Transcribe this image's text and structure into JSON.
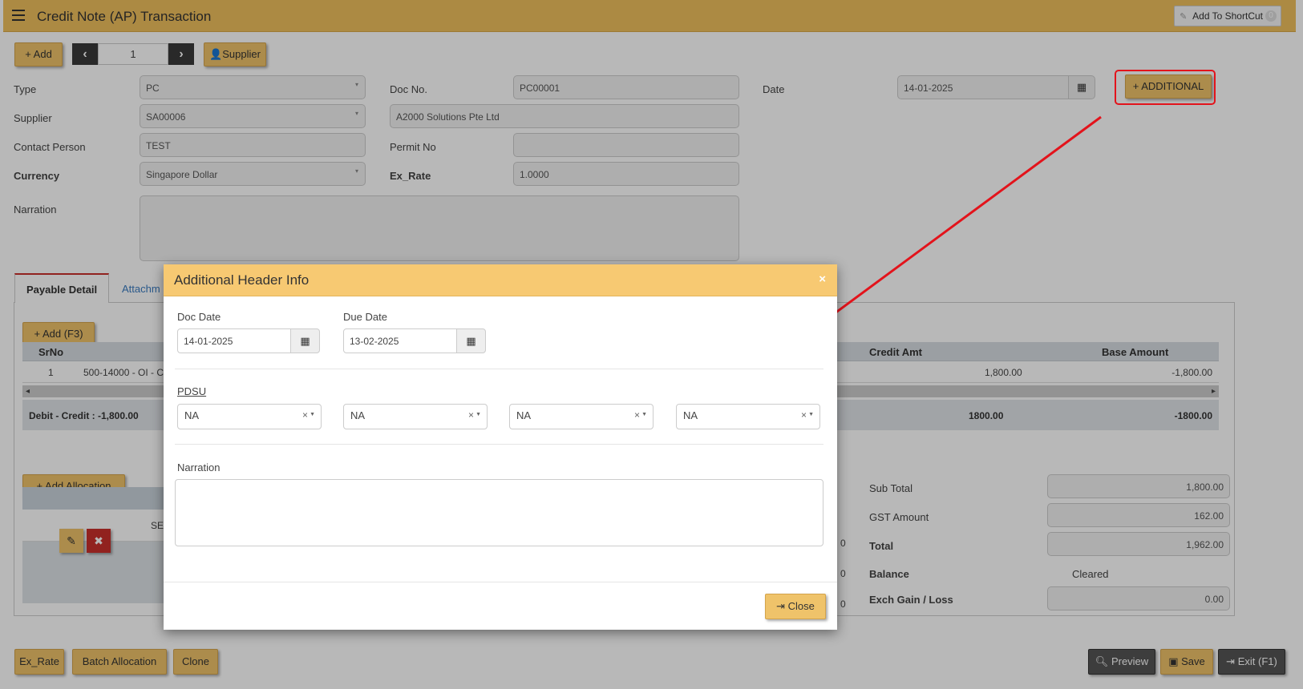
{
  "window": {
    "title": "Credit Note (AP) Transaction",
    "shortcut_label": "Add To ShortCut",
    "shortcut_count": "0"
  },
  "toolbar": {
    "add_label": "+ Add",
    "record_number": "1",
    "supplier_label": "Supplier",
    "additional_label": "+ ADDITIONAL"
  },
  "form": {
    "type_label": "Type",
    "type_value": "PC",
    "docno_label": "Doc No.",
    "docno_value": "PC00001",
    "date_label": "Date",
    "date_value": "14-01-2025",
    "supplier_label": "Supplier",
    "supplier_value": "SA00006",
    "supplier_name": "A2000 Solutions Pte Ltd",
    "contact_label": "Contact Person",
    "contact_value": "TEST",
    "permit_label": "Permit No",
    "permit_value": "",
    "currency_label": "Currency",
    "currency_value": "Singapore Dollar",
    "exrate_label": "Ex_Rate",
    "exrate_value": "1.0000",
    "narration_label": "Narration"
  },
  "tabs": [
    {
      "label": "Payable Detail"
    },
    {
      "label": "Attachm"
    }
  ],
  "detail": {
    "add_label": "+ Add (F3)",
    "headers": {
      "srno": "SrNo",
      "credit": "Credit Amt",
      "base": "Base Amount"
    },
    "row": {
      "srno": "1",
      "account": "500-14000 - OI - C",
      "credit": "1,800.00",
      "base": "-1,800.00"
    },
    "totals": {
      "diff": "Debit - Credit : -1,800.00",
      "credit": "1800.00",
      "base": "-1800.00"
    }
  },
  "allocation": {
    "add_label": "+ Add Allocation",
    "row_text": "SE",
    "edge_digits": [
      "0",
      "0",
      "0"
    ]
  },
  "summary": {
    "subtotal_label": "Sub Total",
    "subtotal_value": "1,800.00",
    "gst_label": "GST Amount",
    "gst_value": "162.00",
    "total_label": "Total",
    "total_value": "1,962.00",
    "balance_label": "Balance",
    "balance_value": "Cleared",
    "exch_label": "Exch Gain / Loss",
    "exch_value": "0.00"
  },
  "footer": {
    "exrate": "Ex_Rate",
    "batch": "Batch Allocation",
    "clone": "Clone",
    "preview": "Preview",
    "save": "Save",
    "exit": "Exit (F1)"
  },
  "modal": {
    "title": "Additional Header Info",
    "doc_date_label": "Doc Date",
    "doc_date_value": "14-01-2025",
    "due_date_label": "Due Date",
    "due_date_value": "13-02-2025",
    "pdsu_label": "PDSU",
    "pdsu_values": [
      "NA",
      "NA",
      "NA",
      "NA"
    ],
    "narration_label": "Narration",
    "close_label": "Close"
  },
  "colors": {
    "header_gold": "#efbf5e",
    "modal_header": "#f7c972",
    "annotation_red": "#e3131b"
  }
}
